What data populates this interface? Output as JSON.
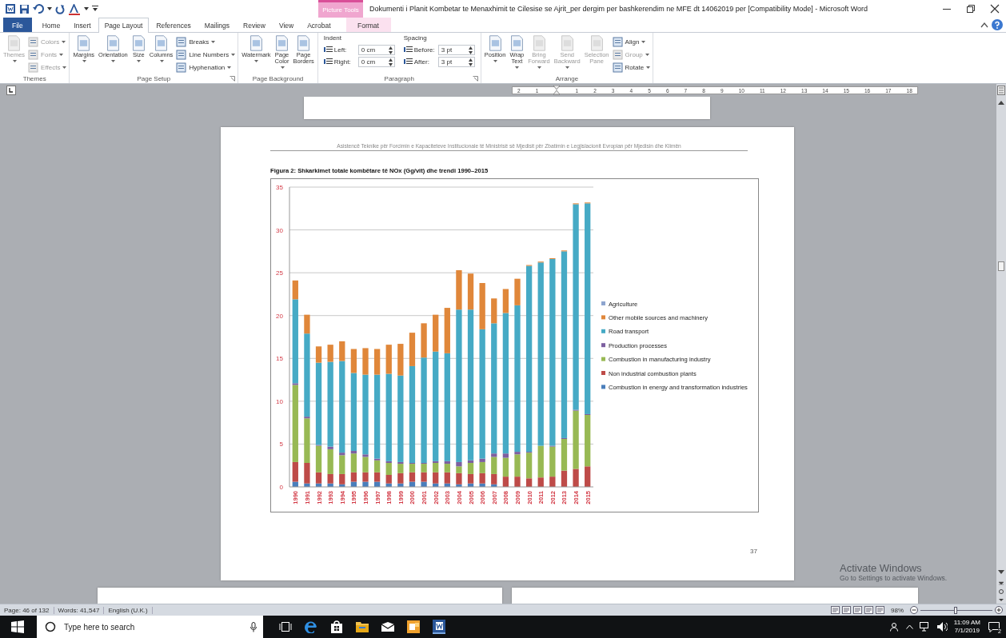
{
  "title_bar": {
    "context_group": "Picture Tools",
    "title": "Dokumenti i Planit Kombetar te Menaxhimit te Cilesise se Ajrit_per dergim per bashkerendim ne MFE dt 14062019 per [Compatibility Mode]  -  Microsoft Word"
  },
  "tabs": [
    {
      "label": "File",
      "kind": "file",
      "selected": false
    },
    {
      "label": "Home",
      "kind": "normal",
      "selected": false
    },
    {
      "label": "Insert",
      "kind": "normal",
      "selected": false
    },
    {
      "label": "Page Layout",
      "kind": "normal",
      "selected": true
    },
    {
      "label": "References",
      "kind": "normal",
      "selected": false
    },
    {
      "label": "Mailings",
      "kind": "normal",
      "selected": false
    },
    {
      "label": "Review",
      "kind": "normal",
      "selected": false
    },
    {
      "label": "View",
      "kind": "normal",
      "selected": false
    },
    {
      "label": "Acrobat",
      "kind": "normal",
      "selected": false
    },
    {
      "label": "Format",
      "kind": "contextual",
      "selected": false
    }
  ],
  "ribbon": [
    {
      "label": "Themes",
      "launcher": false,
      "items": [
        {
          "kind": "large",
          "label": "Themes",
          "disabled": true,
          "dropdown": true
        },
        {
          "kind": "stack",
          "items": [
            {
              "label": "Colors",
              "disabled": true,
              "dropdown": true
            },
            {
              "label": "Fonts",
              "disabled": true,
              "dropdown": true
            },
            {
              "label": "Effects",
              "disabled": true,
              "dropdown": true
            }
          ]
        }
      ]
    },
    {
      "label": "Page Setup",
      "launcher": true,
      "items": [
        {
          "kind": "large",
          "label": "Margins",
          "disabled": false,
          "dropdown": true
        },
        {
          "kind": "large",
          "label": "Orientation",
          "disabled": false,
          "dropdown": true
        },
        {
          "kind": "large",
          "label": "Size",
          "disabled": false,
          "dropdown": true
        },
        {
          "kind": "large",
          "label": "Columns",
          "disabled": false,
          "dropdown": true
        },
        {
          "kind": "stack",
          "items": [
            {
              "label": "Breaks",
              "disabled": false,
              "dropdown": true
            },
            {
              "label": "Line Numbers",
              "disabled": false,
              "dropdown": true
            },
            {
              "label": "Hyphenation",
              "disabled": false,
              "dropdown": true
            }
          ]
        }
      ]
    },
    {
      "label": "Page Background",
      "launcher": false,
      "items": [
        {
          "kind": "large",
          "label": "Watermark",
          "disabled": false,
          "dropdown": true
        },
        {
          "kind": "large",
          "label": "Page Color",
          "disabled": false,
          "dropdown": true
        },
        {
          "kind": "large",
          "label": "Page Borders",
          "disabled": false,
          "dropdown": false
        }
      ]
    },
    {
      "label": "Paragraph",
      "launcher": true,
      "items": [
        {
          "kind": "fields",
          "heading": "Indent",
          "rows": [
            {
              "label": "Left:",
              "value": "0 cm"
            },
            {
              "label": "Right:",
              "value": "0 cm"
            }
          ]
        },
        {
          "kind": "fields",
          "heading": "Spacing",
          "rows": [
            {
              "label": "Before:",
              "value": "3 pt"
            },
            {
              "label": "After:",
              "value": "3 pt"
            }
          ]
        }
      ]
    },
    {
      "label": "Arrange",
      "launcher": false,
      "items": [
        {
          "kind": "large",
          "label": "Position",
          "disabled": false,
          "dropdown": true
        },
        {
          "kind": "large",
          "label": "Wrap Text",
          "disabled": false,
          "dropdown": true
        },
        {
          "kind": "large",
          "label": "Bring Forward",
          "disabled": true,
          "dropdown": true
        },
        {
          "kind": "large",
          "label": "Send Backward",
          "disabled": true,
          "dropdown": true
        },
        {
          "kind": "large",
          "label": "Selection Pane",
          "disabled": true,
          "dropdown": false
        },
        {
          "kind": "stack",
          "items": [
            {
              "label": "Align",
              "disabled": false,
              "dropdown": true
            },
            {
              "label": "Group",
              "disabled": true,
              "dropdown": true
            },
            {
              "label": "Rotate",
              "disabled": false,
              "dropdown": true
            }
          ]
        }
      ]
    }
  ],
  "ruler": {
    "left_marks": [
      "2",
      "1"
    ],
    "marks": [
      "1",
      "2",
      "3",
      "4",
      "5",
      "6",
      "7",
      "8",
      "9",
      "10",
      "11",
      "12",
      "13",
      "14",
      "15",
      "16",
      "17",
      "18"
    ]
  },
  "document": {
    "header": "Asistencë Teknike për Forcimin e Kapaciteteve Institucionale të Ministrisë së Mjedisit për Zbatimin e Legjislacionit Evropian për Mjedisin  dhe Klimën",
    "caption": "Figura 2: Shkarkimet totale kombëtare të NOx (Gg/vit) dhe trendi 1990–2015",
    "page_number": "37",
    "chart_data": {
      "type": "bar",
      "stacked": true,
      "orientation": "vertical",
      "grid": true,
      "legend": true,
      "ylim": [
        0,
        35
      ],
      "yticks": [
        0,
        5,
        10,
        15,
        20,
        25,
        30,
        35
      ],
      "categories": [
        "1990",
        "1991",
        "1992",
        "1993",
        "1994",
        "1995",
        "1996",
        "1997",
        "1998",
        "1999",
        "2000",
        "2001",
        "2002",
        "2003",
        "2004",
        "2005",
        "2006",
        "2007",
        "2008",
        "2009",
        "2010",
        "2011",
        "2012",
        "2013",
        "2014",
        "2015"
      ],
      "series": [
        {
          "name": "Combustion in energy and transformation industries",
          "color": "#4a7ebb",
          "values": [
            0.6,
            0.4,
            0.4,
            0.4,
            0.3,
            0.6,
            0.6,
            0.6,
            0.4,
            0.4,
            0.6,
            0.6,
            0.4,
            0.4,
            0.3,
            0.4,
            0.4,
            0.3,
            0,
            0,
            0,
            0,
            0,
            0,
            0,
            0
          ]
        },
        {
          "name": "Non industrial combustion plants",
          "color": "#be4b48",
          "values": [
            2.3,
            2.4,
            1.3,
            1.1,
            1.2,
            1.1,
            1.1,
            1.1,
            1.0,
            1.2,
            1.1,
            1.1,
            1.3,
            1.3,
            1.3,
            1.1,
            1.2,
            1.2,
            1.2,
            1.2,
            1.0,
            1.1,
            1.2,
            1.9,
            2.1,
            2.4
          ]
        },
        {
          "name": "Combustion in manufacturing industry",
          "color": "#98b954",
          "values": [
            9.0,
            5.2,
            3.1,
            2.9,
            2.2,
            2.2,
            1.8,
            1.4,
            1.4,
            1.1,
            1.0,
            1.0,
            1.1,
            1.0,
            0.8,
            1.3,
            1.3,
            2.0,
            2.2,
            2.6,
            3.0,
            3.7,
            3.5,
            3.7,
            6.8,
            6.0
          ]
        },
        {
          "name": "Production processes",
          "color": "#7d60a0",
          "values": [
            0.2,
            0.2,
            0.1,
            0.3,
            0.3,
            0.3,
            0.3,
            0.2,
            0.2,
            0.2,
            0.1,
            0.1,
            0.2,
            0.3,
            0.5,
            0.3,
            0.4,
            0.4,
            0.5,
            0.3,
            0.1,
            0,
            0.1,
            0.1,
            0.1,
            0.1
          ]
        },
        {
          "name": "Road transport",
          "color": "#46aac5",
          "values": [
            9.8,
            9.7,
            9.6,
            9.9,
            10.7,
            9.1,
            9.3,
            9.8,
            10.2,
            10.1,
            11.3,
            12.3,
            12.8,
            12.6,
            17.8,
            17.6,
            15.1,
            15.2,
            16.4,
            17.1,
            21.7,
            21.4,
            21.8,
            21.8,
            24.0,
            24.6
          ]
        },
        {
          "name": "Other mobile sources and machinery",
          "color": "#e0873a",
          "values": [
            2.2,
            2.2,
            1.9,
            2.0,
            2.3,
            2.8,
            3.1,
            3.0,
            3.4,
            3.7,
            3.9,
            4.0,
            4.3,
            5.3,
            4.6,
            4.2,
            5.4,
            2.9,
            2.8,
            3.1,
            0.1,
            0.1,
            0.1,
            0.1,
            0.1,
            0.1
          ]
        },
        {
          "name": "Agriculture",
          "color": "#8ea5cf",
          "values": [
            0,
            0,
            0,
            0,
            0,
            0,
            0,
            0,
            0,
            0,
            0,
            0,
            0,
            0,
            0,
            0,
            0,
            0,
            0,
            0,
            0,
            0,
            0,
            0,
            0,
            0
          ]
        }
      ]
    }
  },
  "activation_notice": {
    "title": "Activate Windows",
    "text": "Go to Settings to activate Windows."
  },
  "status_bar": {
    "items": [
      "Page: 46 of 132",
      "Words: 41,547",
      "English (U.K.)"
    ],
    "zoom": "98%",
    "zoom_slider": {
      "level": 0.49
    }
  },
  "taskbar": {
    "search_placeholder": "Type here to search",
    "time": "11:09 AM",
    "date": "7/1/2019",
    "notifications": "2"
  }
}
